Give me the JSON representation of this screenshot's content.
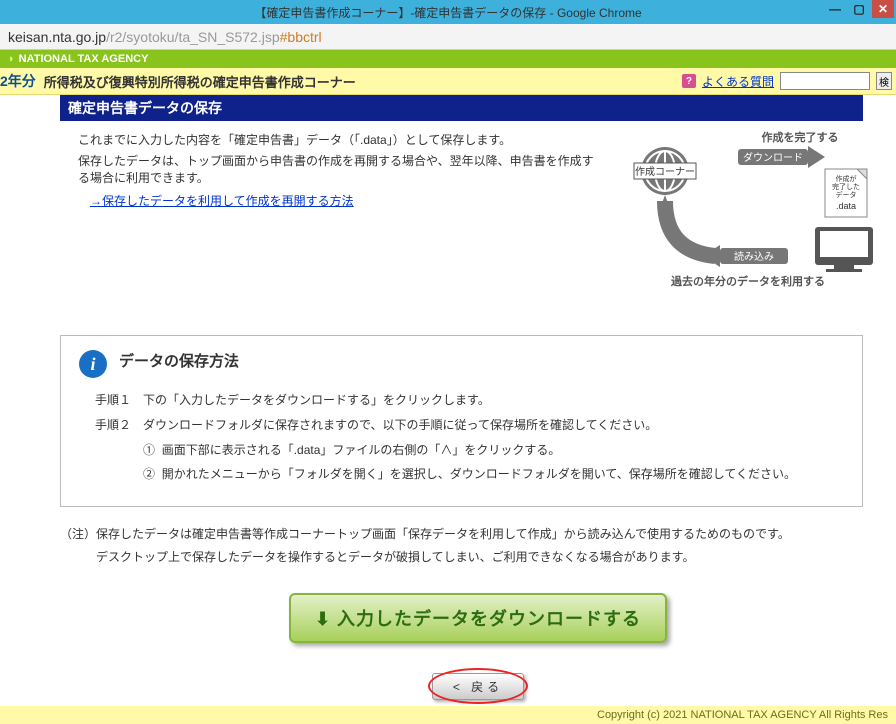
{
  "window": {
    "title": "【確定申告書作成コーナー】-確定申告書データの保存 - Google Chrome"
  },
  "url": {
    "host": "keisan.nta.go.jp",
    "path_gray": "/r2/syotoku/ta_SN_S572.jsp",
    "path_hash": "#bbctrl"
  },
  "agency": "NATIONAL TAX AGENCY",
  "yellowbar": {
    "year": "2年分",
    "title": "所得税及び復興特別所得税の確定申告書作成コーナー",
    "faq_label": "よくある質問",
    "search_btn": "検"
  },
  "blue_title": "確定申告書データの保存",
  "intro": {
    "line1": "これまでに入力した内容を「確定申告書」データ（「.data」）として保存します。",
    "line2": "保存したデータは、トップ画面から申告書の作成を再開する場合や、翌年以降、申告書を作成する場合に利用できます。",
    "link_text": "→保存したデータを利用して作成を再開する方法"
  },
  "diagram": {
    "corner_label": "作成コーナー",
    "complete_label": "作成を完了する",
    "download_label": "ダウンロード",
    "file_label1": "作成が",
    "file_label2": "完了した",
    "file_label3": "データ",
    "file_ext": ".data",
    "readin_label": "読み込み",
    "past_label": "過去の年分のデータを利用する"
  },
  "steps": {
    "title": "データの保存方法",
    "h1_label": "手順１",
    "h1_text": "下の「入力したデータをダウンロードする」をクリックします。",
    "h2_label": "手順２",
    "h2_text": "ダウンロードフォルダに保存されますので、以下の手順に従って保存場所を確認してください。",
    "sub1_no": "①",
    "sub1_text": "画面下部に表示される「.data」ファイルの右側の「∧」をクリックする。",
    "sub2_no": "②",
    "sub2_text": "開かれたメニューから「フォルダを開く」を選択し、ダウンロードフォルダを開いて、保存場所を確認してください。"
  },
  "note": {
    "label": "（注）",
    "line1": "保存したデータは確定申告書等作成コーナートップ画面「保存データを利用して作成」から読み込んで使用するためのものです。",
    "line2": "デスクトップ上で保存したデータを操作するとデータが破損してしまい、ご利用できなくなる場合があります。"
  },
  "buttons": {
    "download": "入力したデータをダウンロードする",
    "back": "< 戻る"
  },
  "footer": "Copyright (c) 2021 NATIONAL TAX AGENCY All Rights Res"
}
